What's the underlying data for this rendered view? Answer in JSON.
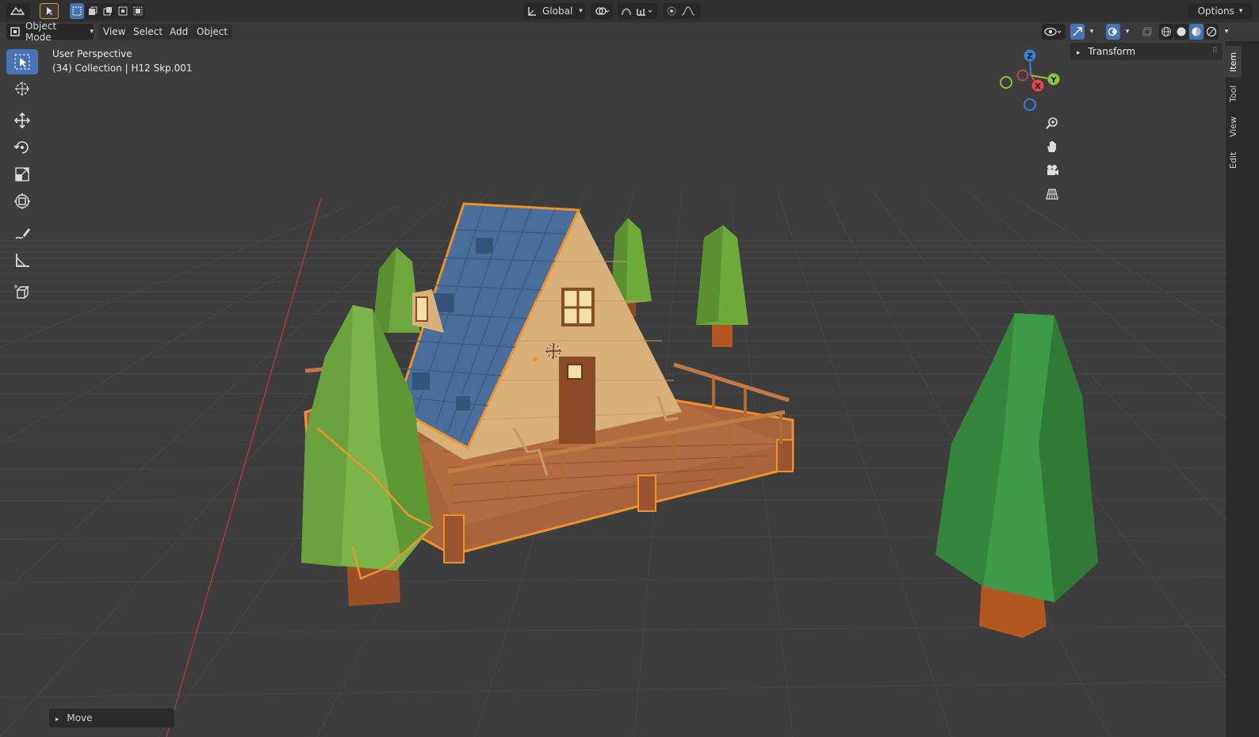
{
  "header": {
    "transform_orientation": "Global",
    "options_label": "Options",
    "mode": "Object Mode",
    "menus": [
      "View",
      "Select",
      "Add",
      "Object"
    ]
  },
  "viewport": {
    "perspective_label": "User Perspective",
    "collection_label": "(34) Collection | H12 Skp.001"
  },
  "gizmo": {
    "z": "Z",
    "y": "Y",
    "x": "X"
  },
  "sidebar": {
    "panel_title": "Transform",
    "tabs": [
      "Item",
      "Tool",
      "View",
      "Edit"
    ]
  },
  "operator_panel": {
    "label": "Move"
  },
  "colors": {
    "accent": "#4772b3",
    "selection_outline": "#f0922c",
    "axis_x": "#e83e52",
    "axis_y": "#8ac43a",
    "axis_z": "#2f83d9"
  },
  "icons": [
    "editor-type-icon",
    "select-box-icon",
    "cursor-icon",
    "move-icon",
    "rotate-icon",
    "scale-icon",
    "transform-icon",
    "annotate-icon",
    "measure-icon",
    "add-cube-icon",
    "zoom-icon",
    "hand-icon",
    "camera-icon",
    "grid-icon"
  ]
}
